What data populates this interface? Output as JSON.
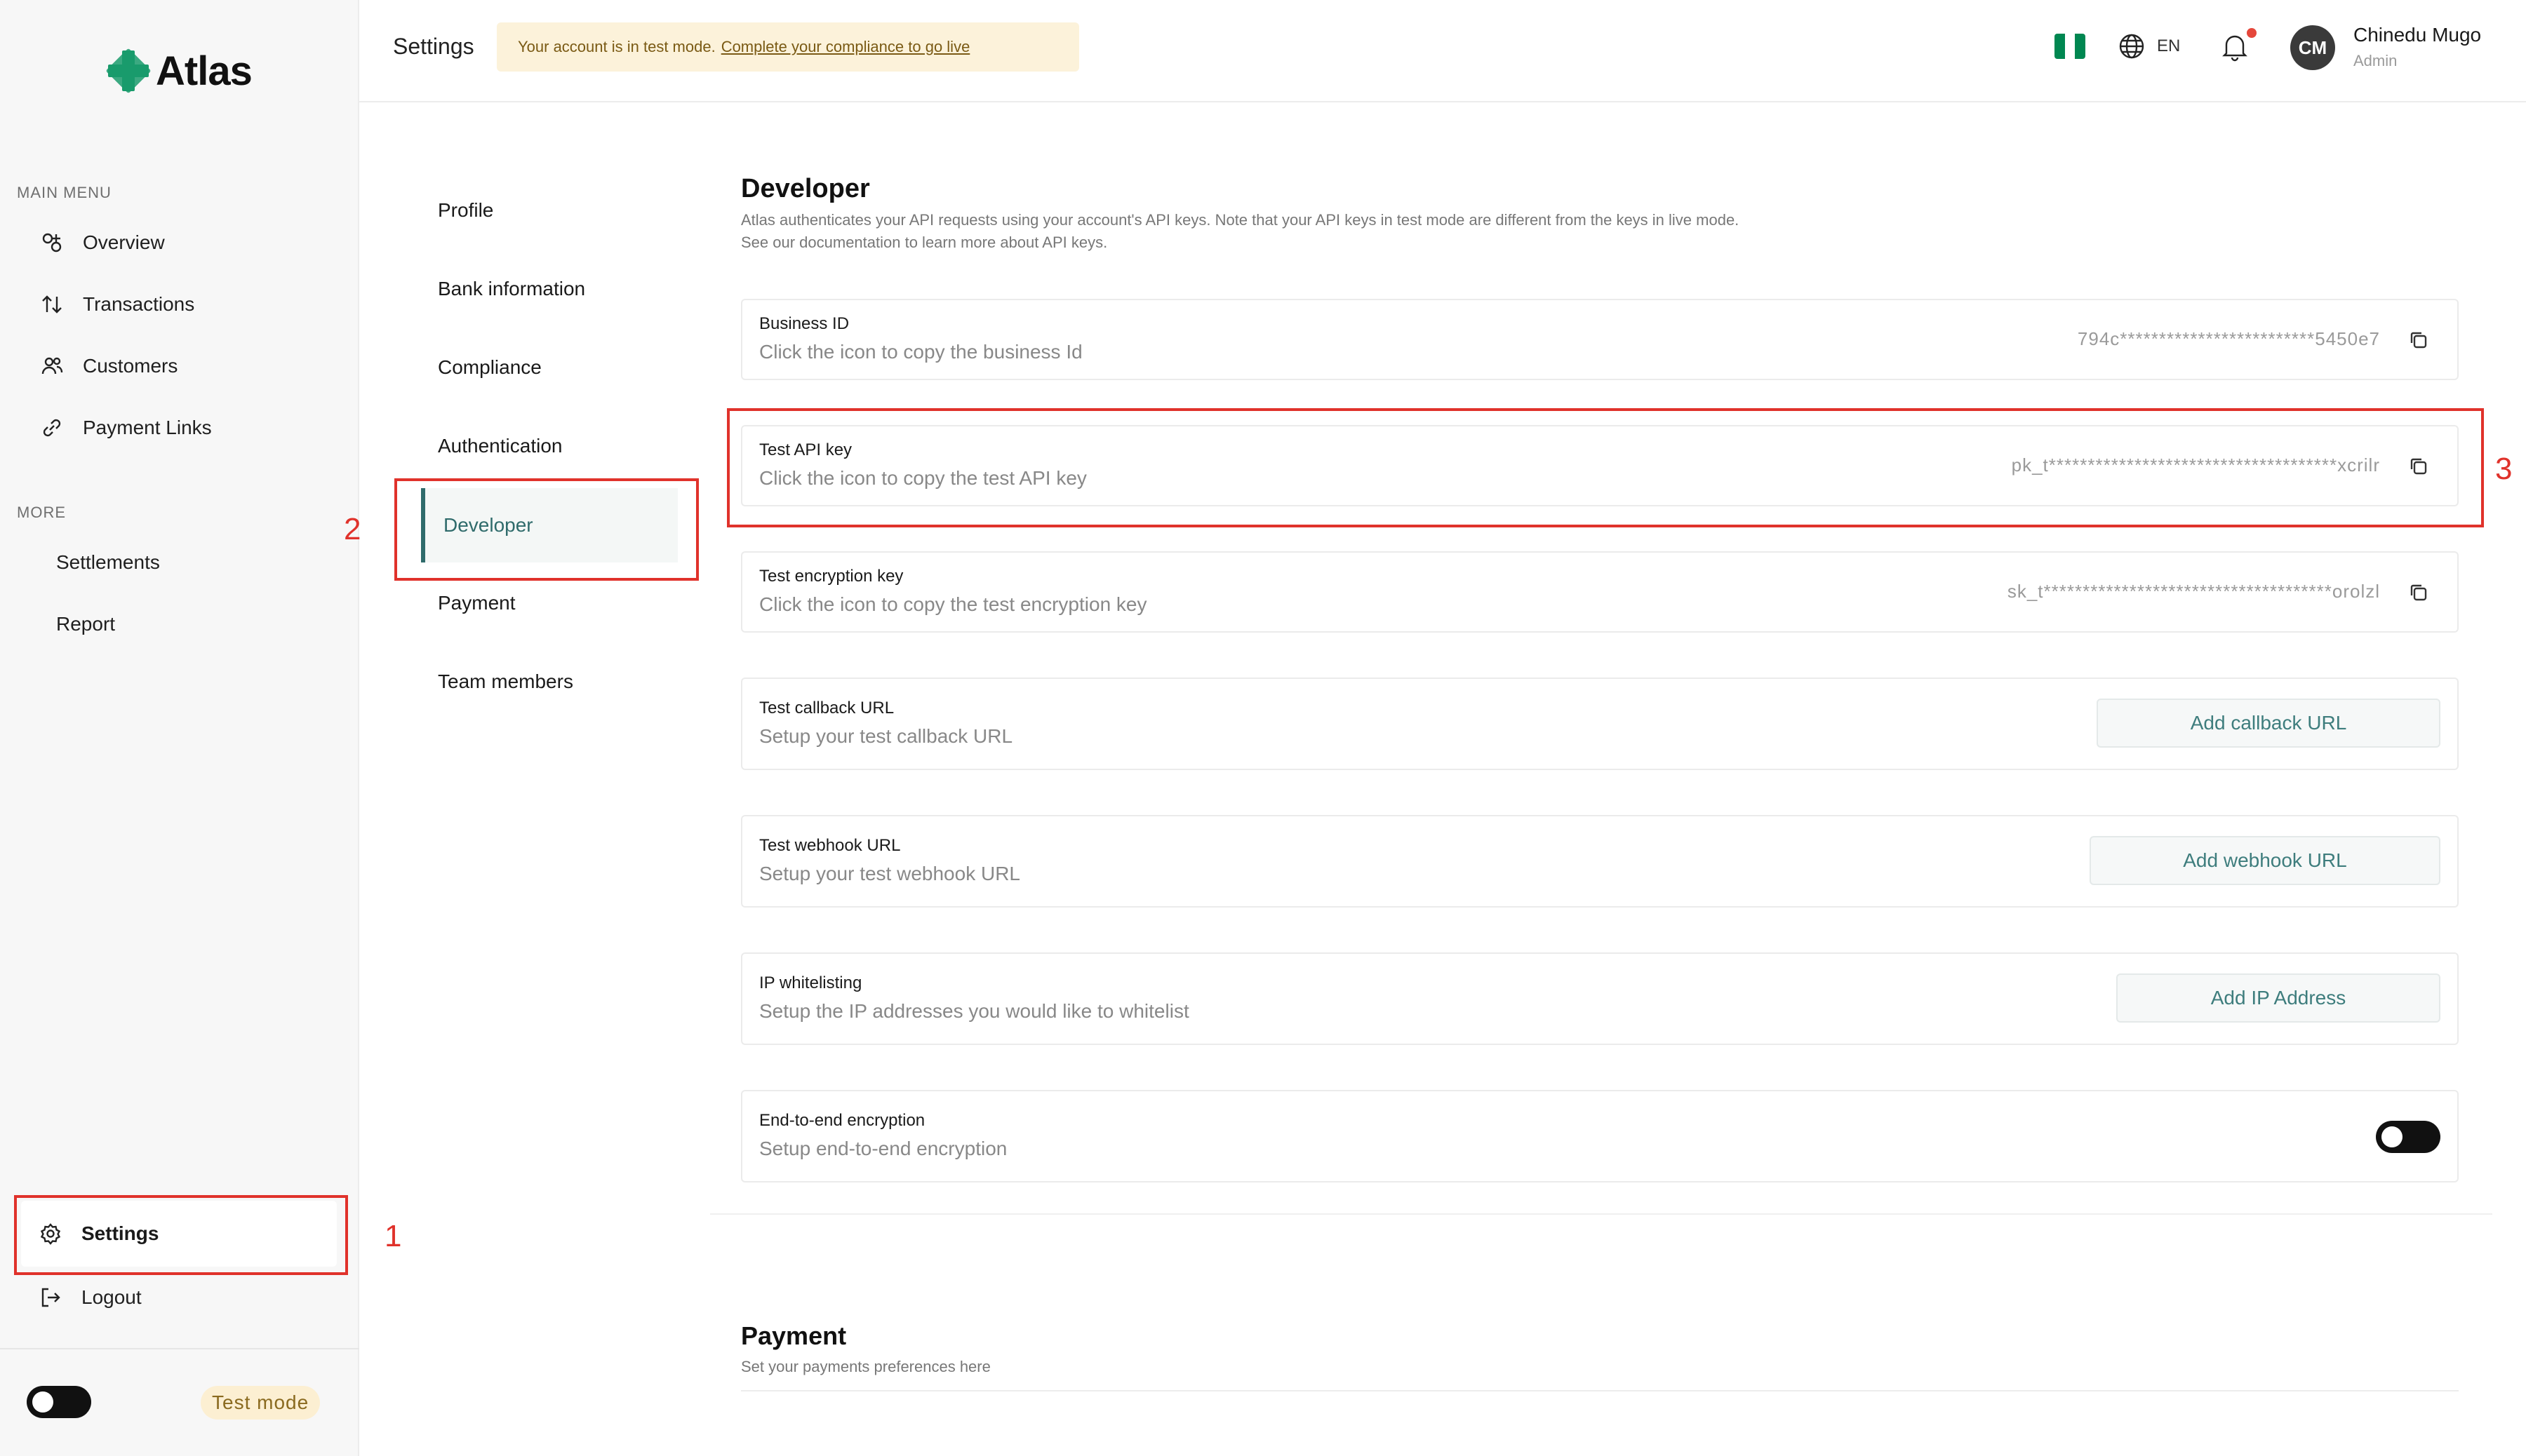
{
  "app": {
    "name": "Atlas",
    "brand_color": "#1a9b6c",
    "accent_color": "#2f6b6b",
    "annotation_color": "#e0322b"
  },
  "sidebar": {
    "main_menu_label": "MAIN MENU",
    "main_items": [
      {
        "label": "Overview",
        "icon": "overview-icon"
      },
      {
        "label": "Transactions",
        "icon": "transactions-icon"
      },
      {
        "label": "Customers",
        "icon": "customers-icon"
      },
      {
        "label": "Payment Links",
        "icon": "link-icon"
      }
    ],
    "more_label": "MORE",
    "more_items": [
      {
        "label": "Settlements"
      },
      {
        "label": "Report"
      }
    ],
    "settings_label": "Settings",
    "logout_label": "Logout",
    "test_mode_label": "Test mode"
  },
  "header": {
    "title": "Settings",
    "banner_text": "Your account is in test mode.",
    "banner_link": "Complete your compliance to go live",
    "language": "EN",
    "avatar_initials": "CM",
    "user_name": "Chinedu Mugo",
    "user_role": "Admin"
  },
  "settings_nav": {
    "items": [
      "Profile",
      "Bank information",
      "Compliance",
      "Authentication",
      "Developer",
      "Payment",
      "Team members"
    ],
    "active": "Developer"
  },
  "developer": {
    "title": "Developer",
    "description_line1": "Atlas authenticates your API requests using your account's API keys. Note that your API keys in test mode are different from the keys in live mode.",
    "description_line2": "See our documentation to learn more about API keys.",
    "business_id": {
      "title": "Business ID",
      "subtitle": "Click the icon to copy the business Id",
      "value": "794c*************************5450e7"
    },
    "test_api_key": {
      "title": "Test API key",
      "subtitle": "Click the icon to copy the test API key",
      "value": "pk_t*************************************xcrilr"
    },
    "test_encryption_key": {
      "title": "Test encryption key",
      "subtitle": "Click the icon to copy the test encryption key",
      "value": "sk_t*************************************orolzl"
    },
    "callback_url": {
      "title": "Test callback URL",
      "subtitle": "Setup your test callback URL",
      "button": "Add callback URL"
    },
    "webhook_url": {
      "title": "Test webhook URL",
      "subtitle": "Setup your test webhook URL",
      "button": "Add webhook URL"
    },
    "ip_whitelisting": {
      "title": "IP whitelisting",
      "subtitle": "Setup the IP addresses you would like to whitelist",
      "button": "Add IP Address"
    },
    "e2e_encryption": {
      "title": "End-to-end encryption",
      "subtitle": "Setup end-to-end encryption",
      "enabled": true
    }
  },
  "payment": {
    "title": "Payment",
    "description": "Set your payments preferences here"
  },
  "annotations": [
    "1",
    "2",
    "3"
  ]
}
